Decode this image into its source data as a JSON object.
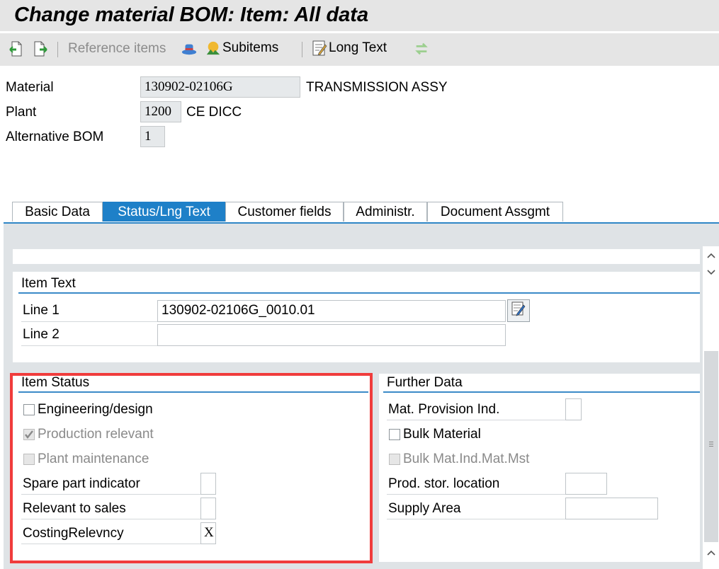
{
  "window": {
    "title": "Change material BOM: Item: All data"
  },
  "toolbar": {
    "reference_items_label": "Reference items",
    "subitems_label": "Subitems",
    "long_text_label": "Long Text"
  },
  "header": {
    "material": {
      "label": "Material",
      "value": "130902-02106G",
      "description": "TRANSMISSION ASSY"
    },
    "plant": {
      "label": "Plant",
      "value": "1200",
      "description": "CE DICC"
    },
    "alternative_bom": {
      "label": "Alternative BOM",
      "value": "1"
    }
  },
  "tabs": [
    {
      "label": "Basic Data",
      "active": false
    },
    {
      "label": "Status/Lng Text",
      "active": true
    },
    {
      "label": "Customer fields",
      "active": false
    },
    {
      "label": "Administr.",
      "active": false
    },
    {
      "label": "Document Assgmt",
      "active": false
    }
  ],
  "item_text": {
    "title": "Item Text",
    "line1_label": "Line 1",
    "line1_value": "130902-02106G_0010.01",
    "line2_label": "Line 2",
    "line2_value": ""
  },
  "item_status": {
    "title": "Item Status",
    "engineering_design": {
      "label": "Engineering/design",
      "checked": false,
      "enabled": true
    },
    "production_relevant": {
      "label": "Production relevant",
      "checked": true,
      "enabled": false
    },
    "plant_maintenance": {
      "label": "Plant maintenance",
      "checked": false,
      "enabled": false
    },
    "spare_part_indicator": {
      "label": "Spare part indicator",
      "value": ""
    },
    "relevant_to_sales": {
      "label": "Relevant to sales",
      "value": ""
    },
    "costing_relevancy": {
      "label": "CostingRelevncy",
      "value": "X"
    }
  },
  "further_data": {
    "title": "Further Data",
    "mat_provision_ind": {
      "label": "Mat. Provision Ind.",
      "value": ""
    },
    "bulk_material": {
      "label": "Bulk Material",
      "checked": false,
      "enabled": true
    },
    "bulk_mat_ind_mat_mst": {
      "label": "Bulk Mat.Ind.Mat.Mst",
      "checked": false,
      "enabled": false
    },
    "prod_stor_location": {
      "label": "Prod. stor. location",
      "value": ""
    },
    "supply_area": {
      "label": "Supply Area",
      "value": ""
    }
  },
  "colors": {
    "active_tab": "#1e80c8",
    "highlight_box": "#f03c3c",
    "section_rule": "#3b8ac8"
  }
}
